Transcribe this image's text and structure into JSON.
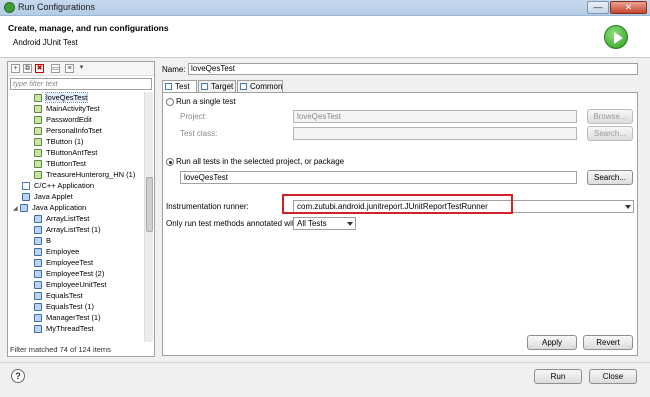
{
  "window": {
    "title": "Run Configurations",
    "close_glyph": "✕",
    "min_glyph": "—"
  },
  "header": {
    "title": "Create, manage, and run configurations",
    "subtitle": "Android JUnit Test"
  },
  "left": {
    "toolbar_icons": [
      "new-config-icon",
      "duplicate-icon",
      "delete-icon",
      "collapse-all-icon",
      "filter-icon",
      "dropdown-icon"
    ],
    "toolbar_glyphs": [
      "+",
      "⧉",
      "✖",
      "▭",
      "≡",
      "▾"
    ],
    "filter_placeholder": "type filter text",
    "tree": [
      {
        "label": "loveQesTest",
        "selected": true
      },
      {
        "label": "MainActivityTest"
      },
      {
        "label": "PasswordEdit"
      },
      {
        "label": "PersonalInfoTset"
      },
      {
        "label": "TButton (1)"
      },
      {
        "label": "TButtonAntTest"
      },
      {
        "label": "TButtonTest"
      },
      {
        "label": "TreasureHunterorg_HN (1)"
      },
      {
        "label": "C/C++ Application"
      },
      {
        "label": "Java Applet"
      },
      {
        "label": "Java Application"
      },
      {
        "label": "ArrayListTest"
      },
      {
        "label": "ArrayListTest (1)"
      },
      {
        "label": "B"
      },
      {
        "label": "Employee"
      },
      {
        "label": "EmployeeTest"
      },
      {
        "label": "EmployeeTest (2)"
      },
      {
        "label": "EmployeeUnitTest"
      },
      {
        "label": "EqualsTest"
      },
      {
        "label": "EqualsTest (1)"
      },
      {
        "label": "ManagerTest (1)"
      },
      {
        "label": "MyThreadTest"
      }
    ],
    "expand_glyph": "◢",
    "status": "Filter matched 74 of 124 items"
  },
  "right": {
    "name_label": "Name:",
    "name_value": "loveQesTest",
    "tabs": [
      "Test",
      "Target",
      "Common"
    ],
    "single_test_label": "Run a single test",
    "project_label": "Project:",
    "project_value": "loveQesTest",
    "browse_label": "Browse...",
    "test_class_label": "Test class:",
    "test_class_value": "",
    "search_label": "Search...",
    "run_all_label": "Run all tests in the selected project, or package",
    "all_value": "loveQesTest",
    "search2_label": "Search...",
    "runner_label": "Instrumentation runner:",
    "runner_value": "com.zutubi.android.junitreport.JUnitReportTestRunner",
    "annot_label": "Only run test methods annotated with:",
    "annot_value": "All Tests",
    "apply_label": "Apply",
    "revert_label": "Revert"
  },
  "footer": {
    "help_glyph": "?",
    "run_label": "Run",
    "close_label": "Close"
  },
  "colors": {
    "highlight": "#d2232a",
    "run_badge": "#2f9b22"
  }
}
